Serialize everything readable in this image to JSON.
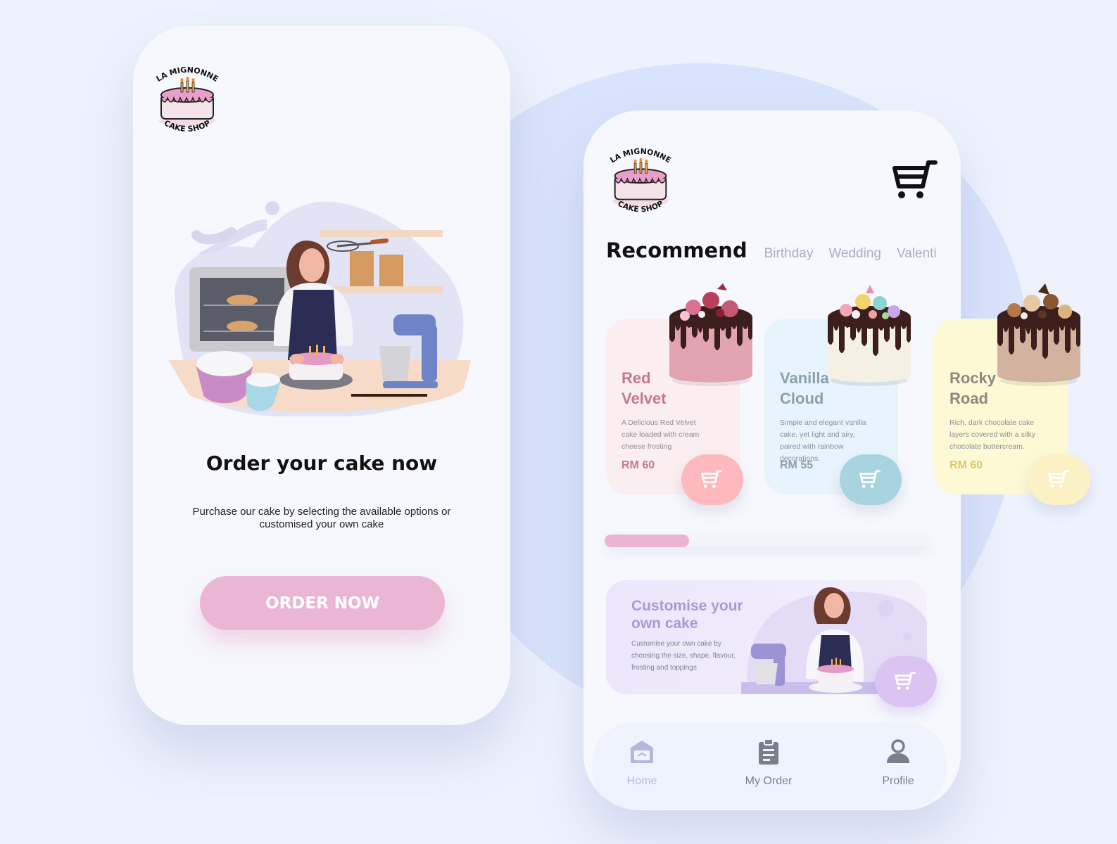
{
  "colors": {
    "background": "#edf2fd",
    "accent_pink": "#ebb6d3",
    "red_velvet": "#c57891",
    "vanilla": "#8aa1a8",
    "rocky_road": "#ddc86e",
    "customise": "#a59bd2"
  },
  "onboarding": {
    "logo": {
      "line1": "LA MIGNONNE",
      "line2": "CAKE SHOP"
    },
    "illustration": "baker-woman-decorating-cake",
    "title": "Order your cake now",
    "subtitle": "Purchase our cake by selecting the available options or customised your own cake",
    "cta_label": "ORDER NOW"
  },
  "home": {
    "logo": {
      "line1": "LA MIGNONNE",
      "line2": "CAKE SHOP"
    },
    "cart_icon": "cart-icon",
    "tabs": [
      {
        "label": "Recommend",
        "active": true
      },
      {
        "label": "Birthday",
        "active": false
      },
      {
        "label": "Wedding",
        "active": false
      },
      {
        "label": "Valenti",
        "active": false
      }
    ],
    "cards": [
      {
        "name_line1": "Red",
        "name_line2": "Velvet",
        "desc": "A Delicious Red Velvet cake  loaded with cream cheese frosting",
        "price": "RM 60"
      },
      {
        "name_line1": "Vanilla",
        "name_line2": "Cloud",
        "desc": "Simple and elegant vanilla cake, yet light and airy,  paired with rainbow decorations.",
        "price": "RM 55"
      },
      {
        "name_line1": "Rocky",
        "name_line2": "Road",
        "desc": "Rich, dark chocolate cake layers covered with a silky chocolate buttercream.",
        "price": "RM 60"
      }
    ],
    "carousel_progress": 0.26,
    "customise": {
      "title_line1": "Customise your",
      "title_line2": "own cake",
      "desc": "Customise your own cake by choosing the size, shape, flavour, frosting and toppings"
    },
    "nav": [
      {
        "label": "Home",
        "icon": "home-icon",
        "active": true
      },
      {
        "label": "My Order",
        "icon": "clipboard-icon",
        "active": false
      },
      {
        "label": "Profile",
        "icon": "user-icon",
        "active": false
      }
    ]
  }
}
